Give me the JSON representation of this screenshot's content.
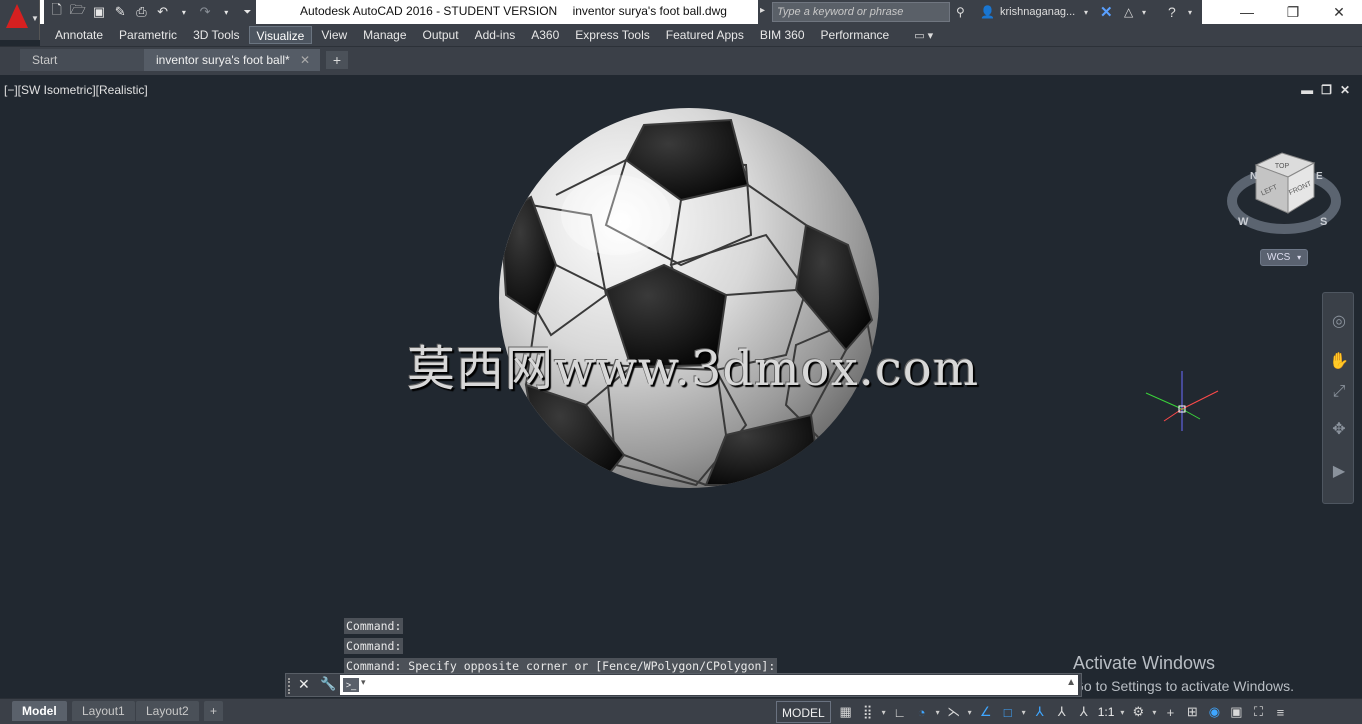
{
  "window": {
    "app_title": "Autodesk AutoCAD 2016 - STUDENT VERSION",
    "file_name": "inventor surya's foot ball.dwg",
    "search_placeholder": "Type a keyword or phrase",
    "user_name": "krishnaganag...",
    "minimize": "—",
    "maximize": "❐",
    "close": "✕"
  },
  "quick_access": {
    "icons": [
      "new-icon",
      "open-icon",
      "save-icon",
      "save-as-icon",
      "print-icon",
      "undo-icon",
      "redo-icon",
      "customize-icon"
    ]
  },
  "ribbon": {
    "tabs": [
      {
        "label": "Annotate"
      },
      {
        "label": "Parametric"
      },
      {
        "label": "3D Tools"
      },
      {
        "label": "Visualize",
        "active": true
      },
      {
        "label": "View"
      },
      {
        "label": "Manage"
      },
      {
        "label": "Output"
      },
      {
        "label": "Add-ins"
      },
      {
        "label": "A360"
      },
      {
        "label": "Express Tools"
      },
      {
        "label": "Featured Apps"
      },
      {
        "label": "BIM 360"
      },
      {
        "label": "Performance"
      }
    ]
  },
  "doc_tabs": {
    "start": "Start",
    "current": "inventor surya's foot ball*",
    "close": "✕",
    "add": "+"
  },
  "viewport": {
    "label": "[−][SW Isometric][Realistic]",
    "watermark": "莫西网www.3dmox.com",
    "wcs_label": "WCS",
    "viewcube": {
      "top": "TOP",
      "left": "LEFT",
      "front": "FRONT",
      "compass": [
        "N",
        "E",
        "W",
        "S"
      ]
    }
  },
  "command": {
    "history": [
      "Command:",
      "Command:",
      "Command: Specify opposite corner or [Fence/WPolygon/CPolygon]:"
    ],
    "input_value": ""
  },
  "activation": {
    "title": "Activate Windows",
    "subtitle": "Go to Settings to activate Windows."
  },
  "status_bar": {
    "layout_tabs": [
      "Model",
      "Layout1",
      "Layout2"
    ],
    "add": "+",
    "model_button": "MODEL",
    "scale": "1:1"
  }
}
